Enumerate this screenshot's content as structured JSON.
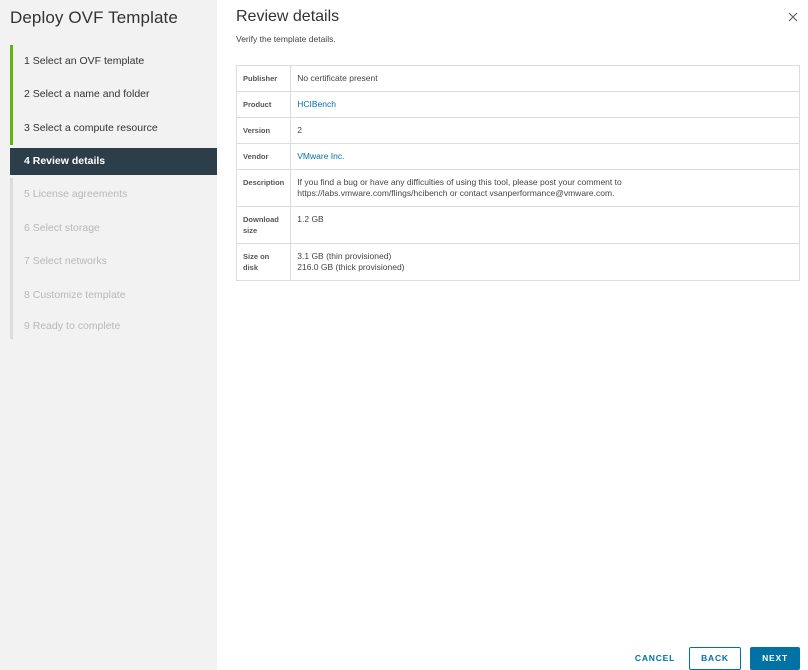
{
  "sidebar": {
    "title": "Deploy OVF Template",
    "steps": [
      {
        "label": "1  Select an OVF template",
        "state": "done"
      },
      {
        "label": "2  Select a name and folder",
        "state": "done"
      },
      {
        "label": "3  Select a compute resource",
        "state": "done"
      },
      {
        "label": "4  Review details",
        "state": "active"
      },
      {
        "label": "5  License agreements",
        "state": "pending"
      },
      {
        "label": "6  Select storage",
        "state": "pending"
      },
      {
        "label": "7  Select networks",
        "state": "pending"
      },
      {
        "label": "8  Customize template",
        "state": "pending"
      },
      {
        "label": "9  Ready to complete",
        "state": "pending"
      }
    ]
  },
  "main": {
    "title": "Review details",
    "subtitle": "Verify the template details.",
    "close_icon": "close-icon",
    "details": [
      {
        "key": "Publisher",
        "value": "No certificate present"
      },
      {
        "key": "Product",
        "value": "HCIBench"
      },
      {
        "key": "Version",
        "value": "2"
      },
      {
        "key": "Vendor",
        "value": "VMware Inc."
      },
      {
        "key": "Description",
        "value": "If you find a bug or have any difficulties of using this tool, please post your comment to",
        "value2": "https://labs.vmware.com/flings/hcibench or contact vsanperformance@vmware.com."
      },
      {
        "key": "Download size",
        "value": "1.2 GB"
      },
      {
        "key": "Size on disk",
        "value": "3.1 GB (thin provisioned)",
        "value2": "216.0 GB (thick provisioned)"
      }
    ]
  },
  "footer": {
    "cancel_label": "CANCEL",
    "back_label": "BACK",
    "next_label": "NEXT"
  },
  "colors": {
    "accent": "#0072a3",
    "step_done": "#60b515",
    "step_active_bg": "#2c3e4a"
  }
}
